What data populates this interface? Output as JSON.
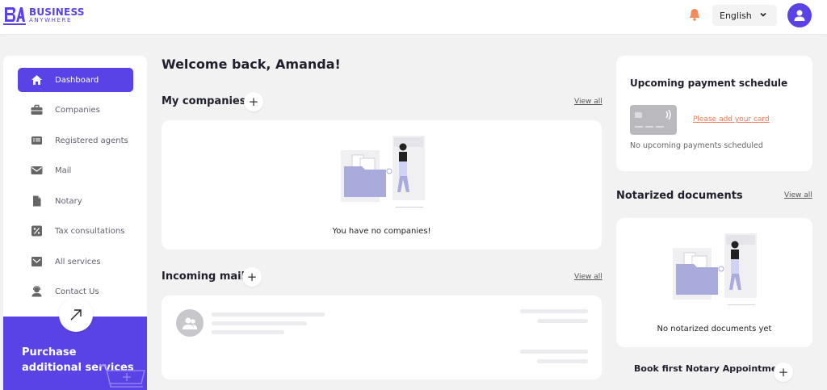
{
  "header": {
    "logo_line1": "BUSINESS",
    "logo_line2": "ANYWHERE",
    "language": "English",
    "accent_color": "#5a43e6",
    "bell_color": "#f28a5a"
  },
  "sidebar": {
    "items": [
      {
        "label": "Dashboard",
        "icon": "home-icon",
        "active": true
      },
      {
        "label": "Companies",
        "icon": "briefcase-icon",
        "active": false
      },
      {
        "label": "Registered agents",
        "icon": "id-card-icon",
        "active": false
      },
      {
        "label": "Mail",
        "icon": "envelope-icon",
        "active": false
      },
      {
        "label": "Notary",
        "icon": "document-icon",
        "active": false
      },
      {
        "label": "Tax consultations",
        "icon": "percent-icon",
        "active": false
      },
      {
        "label": "All services",
        "icon": "mailbox-icon",
        "active": false
      },
      {
        "label": "Contact Us",
        "icon": "support-agent-icon",
        "active": false
      }
    ],
    "promo_text": "Purchase additional services"
  },
  "main": {
    "welcome": "Welcome back, Amanda!",
    "companies": {
      "title": "My companies",
      "view_all": "View all",
      "empty_text": "You have no companies!"
    },
    "mail": {
      "title": "Incoming mail",
      "view_all": "View all"
    }
  },
  "right": {
    "payment": {
      "title": "Upcoming payment schedule",
      "add_card": "Please add your card",
      "empty_text": "No upcoming payments scheduled"
    },
    "notarized": {
      "title": "Notarized documents",
      "view_all": "View all",
      "empty_text": "No notarized documents yet"
    },
    "book_notary": "Book first Notary Appointment"
  }
}
